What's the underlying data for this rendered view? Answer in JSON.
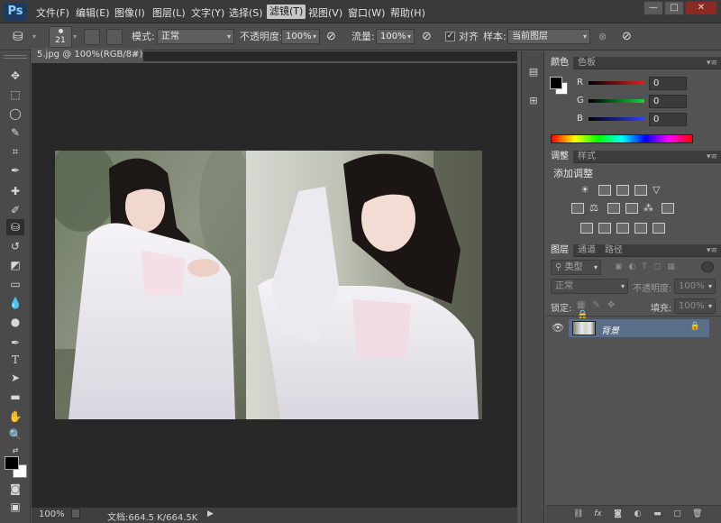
{
  "app": {
    "logo": "Ps"
  },
  "menu": [
    "文件(F)",
    "编辑(E)",
    "图像(I)",
    "图层(L)",
    "文字(Y)",
    "选择(S)",
    "滤镜(T)",
    "视图(V)",
    "窗口(W)",
    "帮助(H)"
  ],
  "window_controls": {
    "minimize": "—",
    "restore": "□",
    "close": "✕"
  },
  "options_bar": {
    "brush_size": "21",
    "mode_label": "模式:",
    "mode_value": "正常",
    "opacity_label": "不透明度:",
    "opacity_value": "100%",
    "flow_label": "流量:",
    "flow_value": "100%",
    "aligned_checked": true,
    "aligned_label": "对齐",
    "sample_label": "样本:",
    "sample_value": "当前图层"
  },
  "document": {
    "tab_title": "5.jpg @ 100%(RGB/8#)",
    "tab_close": "×",
    "zoom": "100%",
    "doc_info": "文档:664.5 K/664.5K"
  },
  "panels": {
    "color": {
      "tabs": [
        "颜色",
        "色板"
      ],
      "channels": [
        {
          "label": "R",
          "value": "0"
        },
        {
          "label": "G",
          "value": "0"
        },
        {
          "label": "B",
          "value": "0"
        }
      ]
    },
    "adjustments": {
      "tabs": [
        "调整",
        "样式"
      ],
      "heading": "添加调整"
    },
    "layers": {
      "tabs": [
        "图层",
        "通道",
        "路径"
      ],
      "filter_kind": "类型",
      "blend_mode": "正常",
      "opacity_label": "不透明度:",
      "opacity_value": "100%",
      "lock_label": "锁定:",
      "fill_label": "填充:",
      "fill_value": "100%",
      "layer_name": "背景"
    }
  },
  "colors": {
    "accent_layer_selected": "#5b6e88",
    "foreground": "#000000",
    "background": "#ffffff"
  }
}
